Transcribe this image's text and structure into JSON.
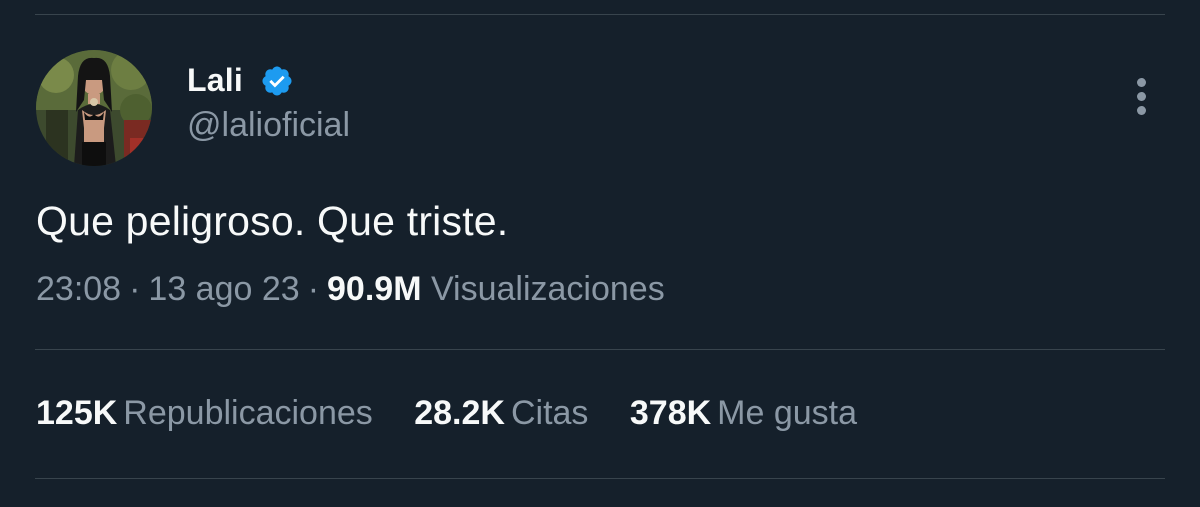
{
  "author": {
    "display_name": "Lali",
    "handle": "@lalioficial",
    "verified": true,
    "verified_color": "#1d9bf0"
  },
  "tweet": {
    "text": "Que peligroso. Que triste.",
    "time": "23:08",
    "date": "13 ago 23",
    "separator": "·",
    "views_count": "90.9M",
    "views_label": "Visualizaciones"
  },
  "stats": [
    {
      "count": "125K",
      "label": "Republicaciones"
    },
    {
      "count": "28.2K",
      "label": "Citas"
    },
    {
      "count": "378K",
      "label": "Me gusta"
    }
  ],
  "icons": {
    "more": "more-vertical-icon",
    "verified": "verified-badge-icon"
  },
  "colors": {
    "background": "#15202b",
    "text_primary": "#f7f9f9",
    "text_secondary": "#8b98a5",
    "divider": "#38444d"
  }
}
